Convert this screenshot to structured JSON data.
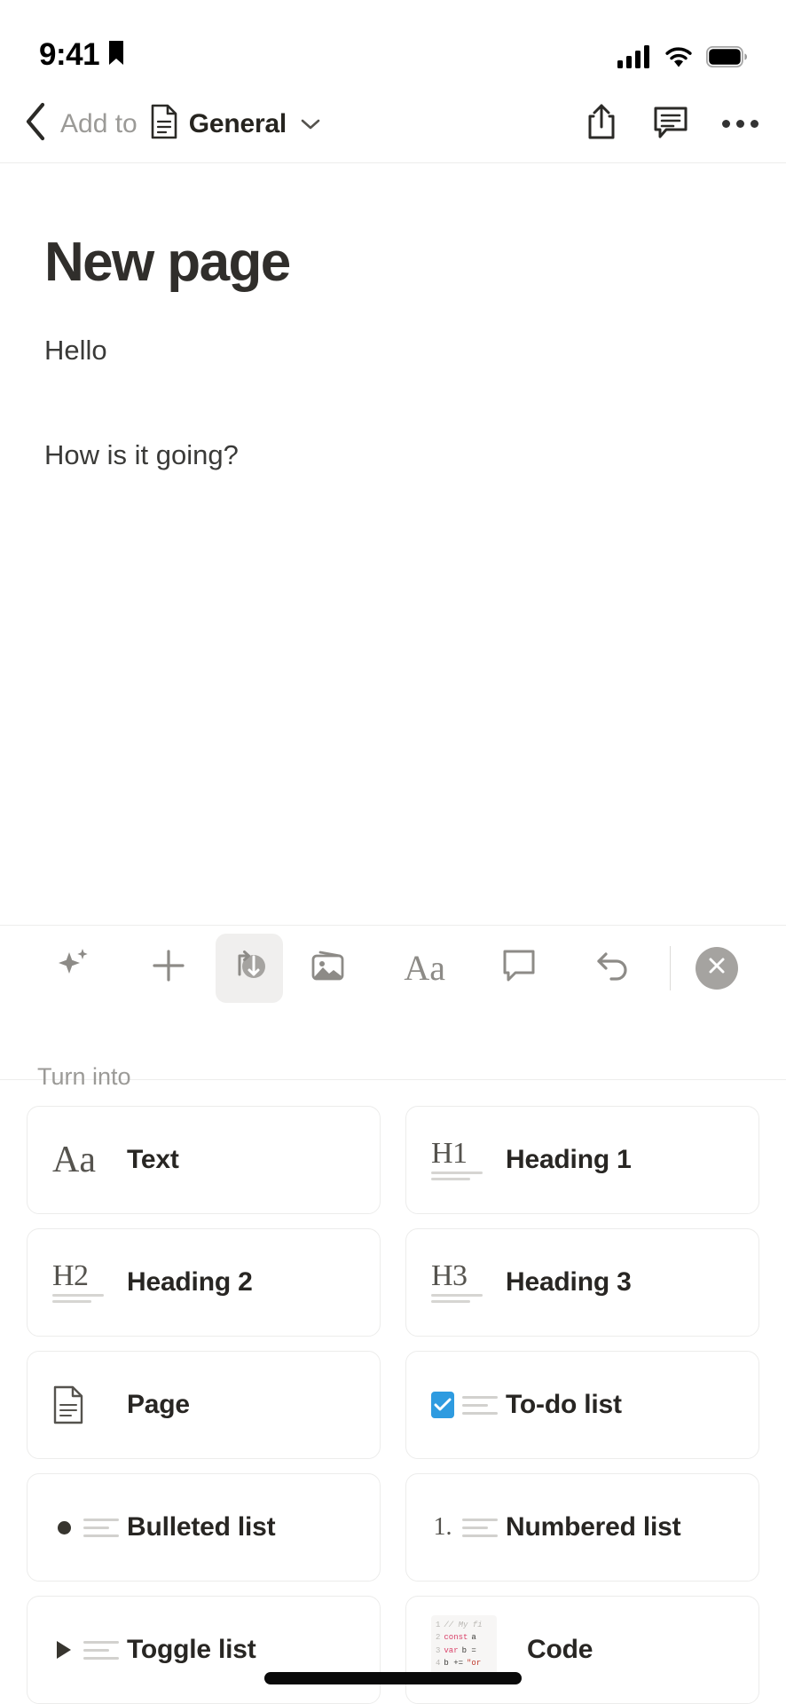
{
  "status_bar": {
    "time": "9:41",
    "bookmark_icon": "bookmark-icon",
    "cellular_icon": "cellular-signal-icon",
    "wifi_icon": "wifi-icon",
    "battery_icon": "battery-icon"
  },
  "nav_bar": {
    "back_icon": "chevron-left-icon",
    "add_to_label": "Add to",
    "doc_icon": "document-icon",
    "destination": "General",
    "chevron_icon": "chevron-down-icon",
    "share_icon": "share-icon",
    "comment_icon": "comment-icon",
    "more_icon": "more-horizontal-icon"
  },
  "page": {
    "title": "New page",
    "blocks": [
      {
        "text": "Hello"
      },
      {
        "text": "How is it going?"
      }
    ]
  },
  "toolbar": {
    "items": [
      {
        "name": "ai-sparkle-button",
        "icon": "sparkle-icon",
        "active": false
      },
      {
        "name": "add-block-button",
        "icon": "plus-icon",
        "active": false
      },
      {
        "name": "turn-into-button",
        "icon": "transform-arrows-icon",
        "active": true
      },
      {
        "name": "media-button",
        "icon": "image-icon",
        "active": false
      },
      {
        "name": "text-format-button",
        "icon": "aa-icon",
        "label": "Aa",
        "active": false
      },
      {
        "name": "comment-button",
        "icon": "comment-bubble-icon",
        "active": false
      },
      {
        "name": "undo-button",
        "icon": "undo-icon",
        "active": false
      }
    ],
    "close_icon": "close-icon"
  },
  "block_menu": {
    "section_label": "Turn into",
    "checkbox_color": "#2E9BE0",
    "options": [
      {
        "label": "Text",
        "icon": "aa-serif-icon",
        "icon_text": "Aa"
      },
      {
        "label": "Heading 1",
        "icon": "heading-1-icon",
        "icon_text": "H1"
      },
      {
        "label": "Heading 2",
        "icon": "heading-2-icon",
        "icon_text": "H2"
      },
      {
        "label": "Heading 3",
        "icon": "heading-3-icon",
        "icon_text": "H3"
      },
      {
        "label": "Page",
        "icon": "page-document-icon",
        "icon_text": ""
      },
      {
        "label": "To-do list",
        "icon": "checkbox-list-icon",
        "icon_text": ""
      },
      {
        "label": "Bulleted list",
        "icon": "bulleted-list-icon",
        "icon_text": ""
      },
      {
        "label": "Numbered list",
        "icon": "numbered-list-icon",
        "icon_text": "1."
      },
      {
        "label": "Toggle list",
        "icon": "toggle-list-icon",
        "icon_text": ""
      },
      {
        "label": "Code",
        "icon": "code-block-icon",
        "icon_text": ""
      }
    ],
    "code_preview": [
      {
        "no": "1",
        "parts": [
          {
            "t": "// My fi",
            "c": "c-com"
          }
        ]
      },
      {
        "no": "2",
        "parts": [
          {
            "t": "const",
            "c": "c-kw"
          },
          {
            "t": "a",
            "c": "c-var"
          }
        ]
      },
      {
        "no": "3",
        "parts": [
          {
            "t": "var",
            "c": "c-kw"
          },
          {
            "t": "b =",
            "c": "c-var"
          }
        ]
      },
      {
        "no": "4",
        "parts": [
          {
            "t": "b +=",
            "c": "c-var"
          },
          {
            "t": "\"or",
            "c": "c-str"
          }
        ]
      }
    ]
  }
}
